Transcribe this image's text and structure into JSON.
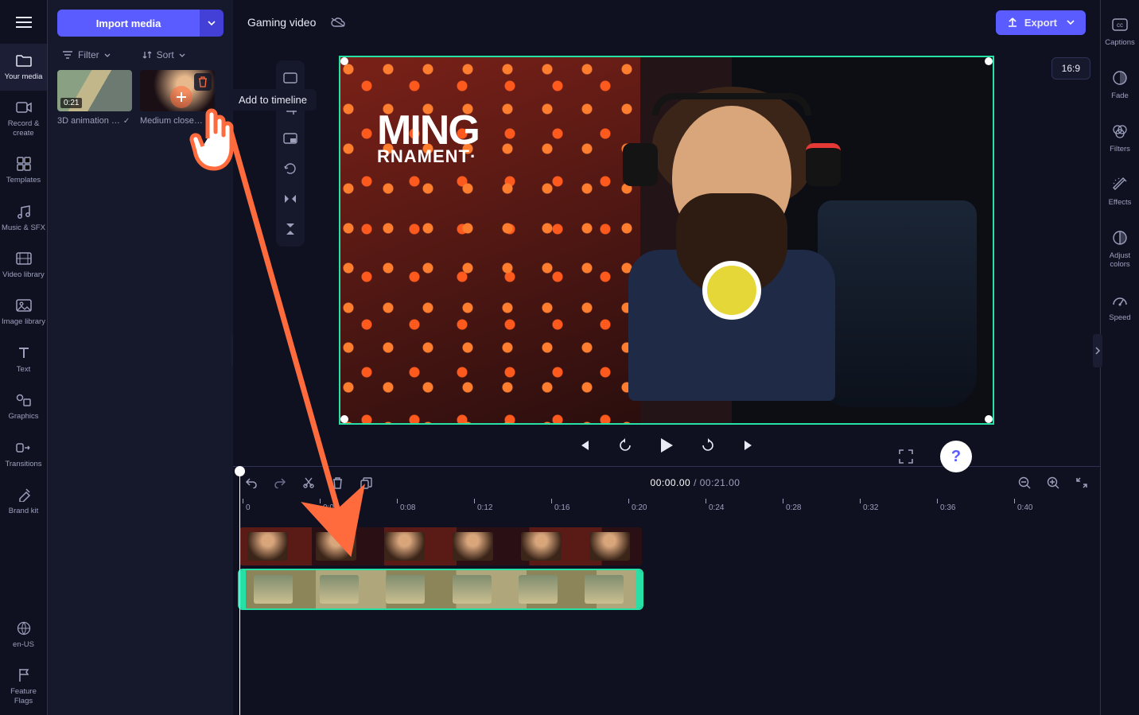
{
  "nav_left": {
    "items": [
      {
        "id": "your-media",
        "label": "Your media"
      },
      {
        "id": "record",
        "label": "Record & create"
      },
      {
        "id": "templates",
        "label": "Templates"
      },
      {
        "id": "music",
        "label": "Music & SFX"
      },
      {
        "id": "video-lib",
        "label": "Video library"
      },
      {
        "id": "image-lib",
        "label": "Image library"
      },
      {
        "id": "text",
        "label": "Text"
      },
      {
        "id": "graphics",
        "label": "Graphics"
      },
      {
        "id": "transitions",
        "label": "Transitions"
      },
      {
        "id": "brand",
        "label": "Brand kit"
      }
    ],
    "locale": "en-US",
    "feature_flags": "Feature Flags"
  },
  "media_panel": {
    "import_label": "Import media",
    "filter_label": "Filter",
    "sort_label": "Sort",
    "items": [
      {
        "name": "3D animation …",
        "duration": "0:21",
        "used": true
      },
      {
        "name": "Medium close…",
        "duration": "",
        "used": false
      }
    ],
    "tooltip": "Add to timeline"
  },
  "header": {
    "project_name": "Gaming video",
    "export_label": "Export",
    "aspect_ratio": "16:9"
  },
  "preview": {
    "overlay_text_1": "MING",
    "overlay_text_2": "RNAMENT·"
  },
  "timeline": {
    "current": "00:00.00",
    "total": "00:21.00",
    "ticks": [
      "0",
      "0:04",
      "0:08",
      "0:12",
      "0:16",
      "0:20",
      "0:24",
      "0:28",
      "0:32",
      "0:36",
      "0:40"
    ]
  },
  "nav_right": {
    "items": [
      {
        "id": "captions",
        "label": "Captions"
      },
      {
        "id": "fade",
        "label": "Fade"
      },
      {
        "id": "filters",
        "label": "Filters"
      },
      {
        "id": "effects",
        "label": "Effects"
      },
      {
        "id": "adjust",
        "label": "Adjust colors"
      },
      {
        "id": "speed",
        "label": "Speed"
      }
    ]
  },
  "icons": {
    "hamburger": "☰"
  }
}
